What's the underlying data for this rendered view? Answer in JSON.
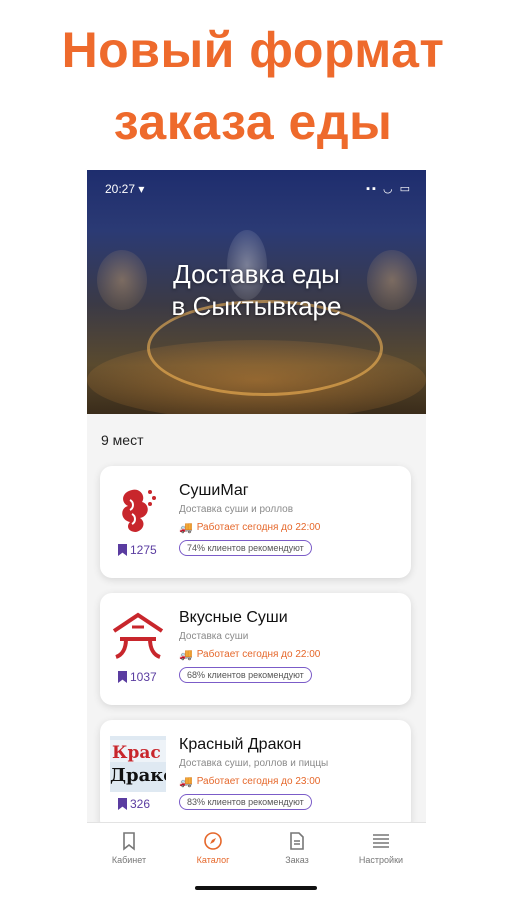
{
  "headline": {
    "line1": "Новый формат",
    "line2": "заказа еды"
  },
  "status_bar": {
    "time": "20:27 ▾",
    "icons": "▪▪ ◡ ▭"
  },
  "hero": {
    "title_line1": "Доставка еды",
    "title_line2": "в Сыктывкаре"
  },
  "places_count": "9 мест",
  "restaurants": [
    {
      "name": "СушиМаг",
      "description": "Доставка суши и роллов",
      "hours": "Работает сегодня до 22:00",
      "bookmarks": "1275",
      "recommend": "74% клиентов рекомендуют"
    },
    {
      "name": "Вкусные Суши",
      "description": "Доставка суши",
      "hours": "Работает сегодня до 22:00",
      "bookmarks": "1037",
      "recommend": "68% клиентов рекомендуют"
    },
    {
      "name": "Красный Дракон",
      "description": "Доставка суши, роллов и пиццы",
      "hours": "Работает сегодня до 23:00",
      "bookmarks": "326",
      "recommend": "83% клиентов рекомендуют",
      "logo_text_line1": "Крас",
      "logo_text_line2": "Драко"
    }
  ],
  "tabs": [
    {
      "label": "Кабинет",
      "icon": "bookmark-icon"
    },
    {
      "label": "Каталог",
      "icon": "compass-icon",
      "active": true
    },
    {
      "label": "Заказ",
      "icon": "document-icon"
    },
    {
      "label": "Настройки",
      "icon": "menu-icon"
    }
  ],
  "colors": {
    "accent": "#e5672a",
    "headline": "#ee6a2c",
    "bookmark": "#5a3ca0",
    "recommend_border": "#7b5cc8"
  }
}
